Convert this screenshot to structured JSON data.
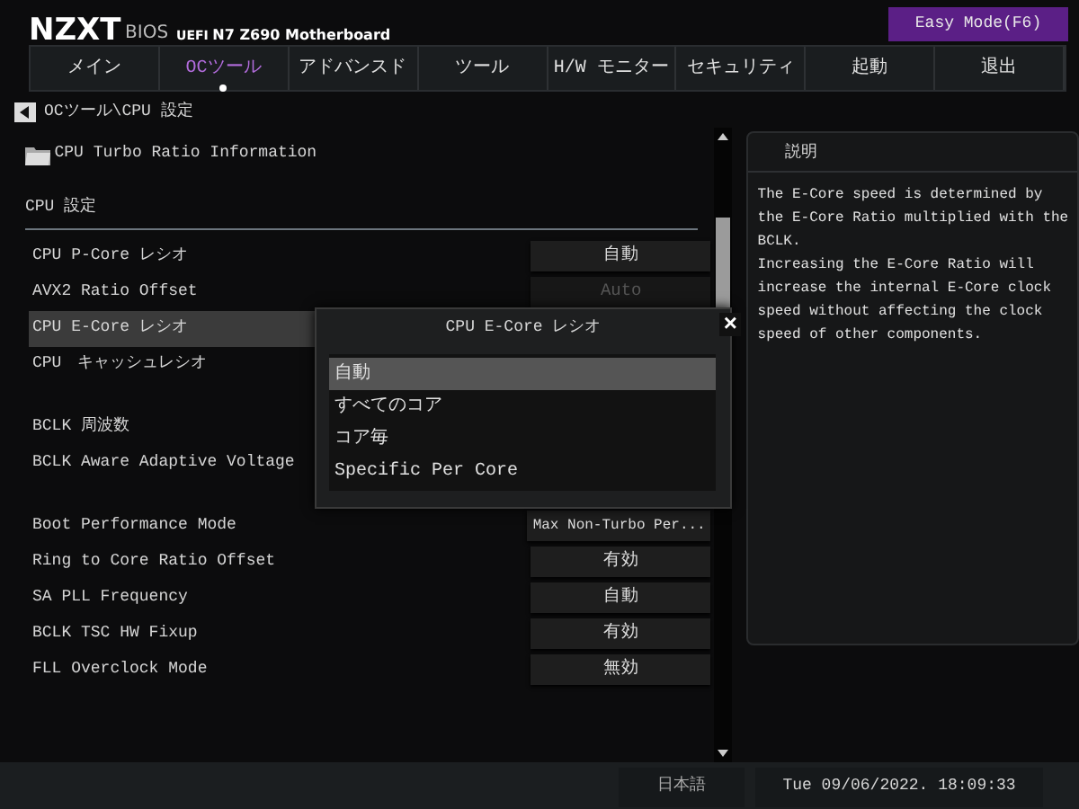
{
  "header": {
    "brand": "NZXT",
    "bios": "BIOS",
    "uefi": "UEFI",
    "board": "N7 Z690 Motherboard",
    "mode_button": "Easy Mode(F6)"
  },
  "tabs": [
    {
      "label": "メイン",
      "selected": false
    },
    {
      "label": "OCツール",
      "selected": true
    },
    {
      "label": "アドバンスド",
      "selected": false
    },
    {
      "label": "ツール",
      "selected": false
    },
    {
      "label": "H/W モニター",
      "selected": false
    },
    {
      "label": "セキュリティ",
      "selected": false
    },
    {
      "label": "起動",
      "selected": false
    },
    {
      "label": "退出",
      "selected": false
    }
  ],
  "breadcrumb": "OCツール\\CPU 設定",
  "folder": "CPU Turbo Ratio Information",
  "section": "CPU 設定",
  "settings": [
    {
      "label": "CPU P-Core レシオ",
      "value": "自動",
      "disabled": false,
      "highlighted": false
    },
    {
      "label": "AVX2 Ratio Offset",
      "value": "Auto",
      "disabled": true,
      "highlighted": false
    },
    {
      "label": "CPU E-Core レシオ",
      "highlighted": true
    },
    {
      "label": "CPU　キャッシュレシオ",
      "highlighted": false
    },
    {
      "kind": "gap"
    },
    {
      "label": "BCLK 周波数",
      "highlighted": false
    },
    {
      "label": "BCLK Aware Adaptive Voltage",
      "highlighted": false
    },
    {
      "kind": "gap"
    },
    {
      "label": "Boot Performance Mode",
      "value": "Max Non-Turbo Per...",
      "disabled": false,
      "highlighted": false
    },
    {
      "label": "Ring to Core Ratio Offset",
      "value": "有効",
      "disabled": false,
      "highlighted": false
    },
    {
      "label": "SA PLL Frequency",
      "value": "自動",
      "disabled": false,
      "highlighted": false
    },
    {
      "label": "BCLK TSC HW Fixup",
      "value": "有効",
      "disabled": false,
      "highlighted": false
    },
    {
      "label": "FLL Overclock Mode",
      "value": "無効",
      "disabled": false,
      "highlighted": false
    }
  ],
  "dialog": {
    "title": "CPU E-Core レシオ",
    "close": "×",
    "options": [
      {
        "label": "自動",
        "selected": true
      },
      {
        "label": "すべてのコア",
        "selected": false
      },
      {
        "label": "コア毎",
        "selected": false
      },
      {
        "label": "Specific Per Core",
        "selected": false
      }
    ]
  },
  "help": {
    "title": "説明",
    "paragraphs": [
      "The E-Core speed is determined by the E-Core Ratio multiplied with the BCLK.",
      "Increasing the E-Core Ratio will increase the internal E-Core clock speed without affecting the clock speed of other components."
    ]
  },
  "status_bar": {
    "language": "日本語",
    "datetime": "Tue 09/06/2022. 18:09:33"
  }
}
